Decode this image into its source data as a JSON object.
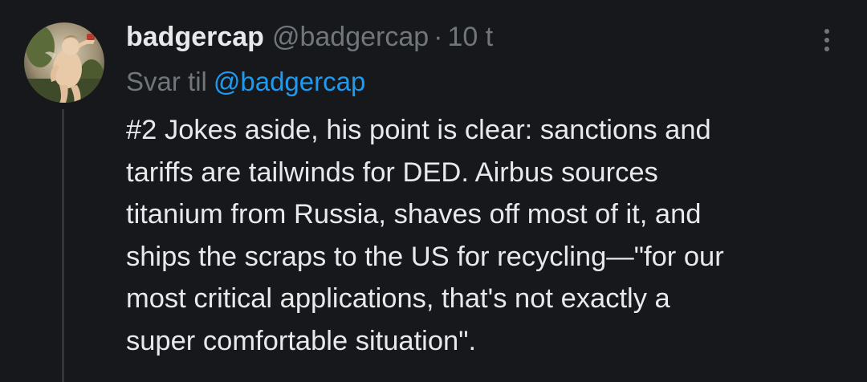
{
  "tweet": {
    "author": {
      "display_name": "badgercap",
      "handle": "@badgercap",
      "separator": "·",
      "time": "10 t"
    },
    "reply_to": {
      "prefix": "Svar til",
      "handle": "@badgercap"
    },
    "body_lines": [
      "#2 Jokes aside, his point is clear: sanctions and",
      "tariffs are tailwinds for DED. Airbus sources",
      "titanium from Russia, shaves off most of it, and",
      "ships the scraps to the US for recycling—\"for our",
      "most critical applications, that's not exactly a",
      "super comfortable situation\"."
    ],
    "more_icon": "more-vertical-icon"
  },
  "colors": {
    "background": "#16181c",
    "primary_text": "#e7e9ea",
    "secondary_text": "#71767b",
    "link": "#1d9bf0",
    "thread_line": "#333639"
  }
}
